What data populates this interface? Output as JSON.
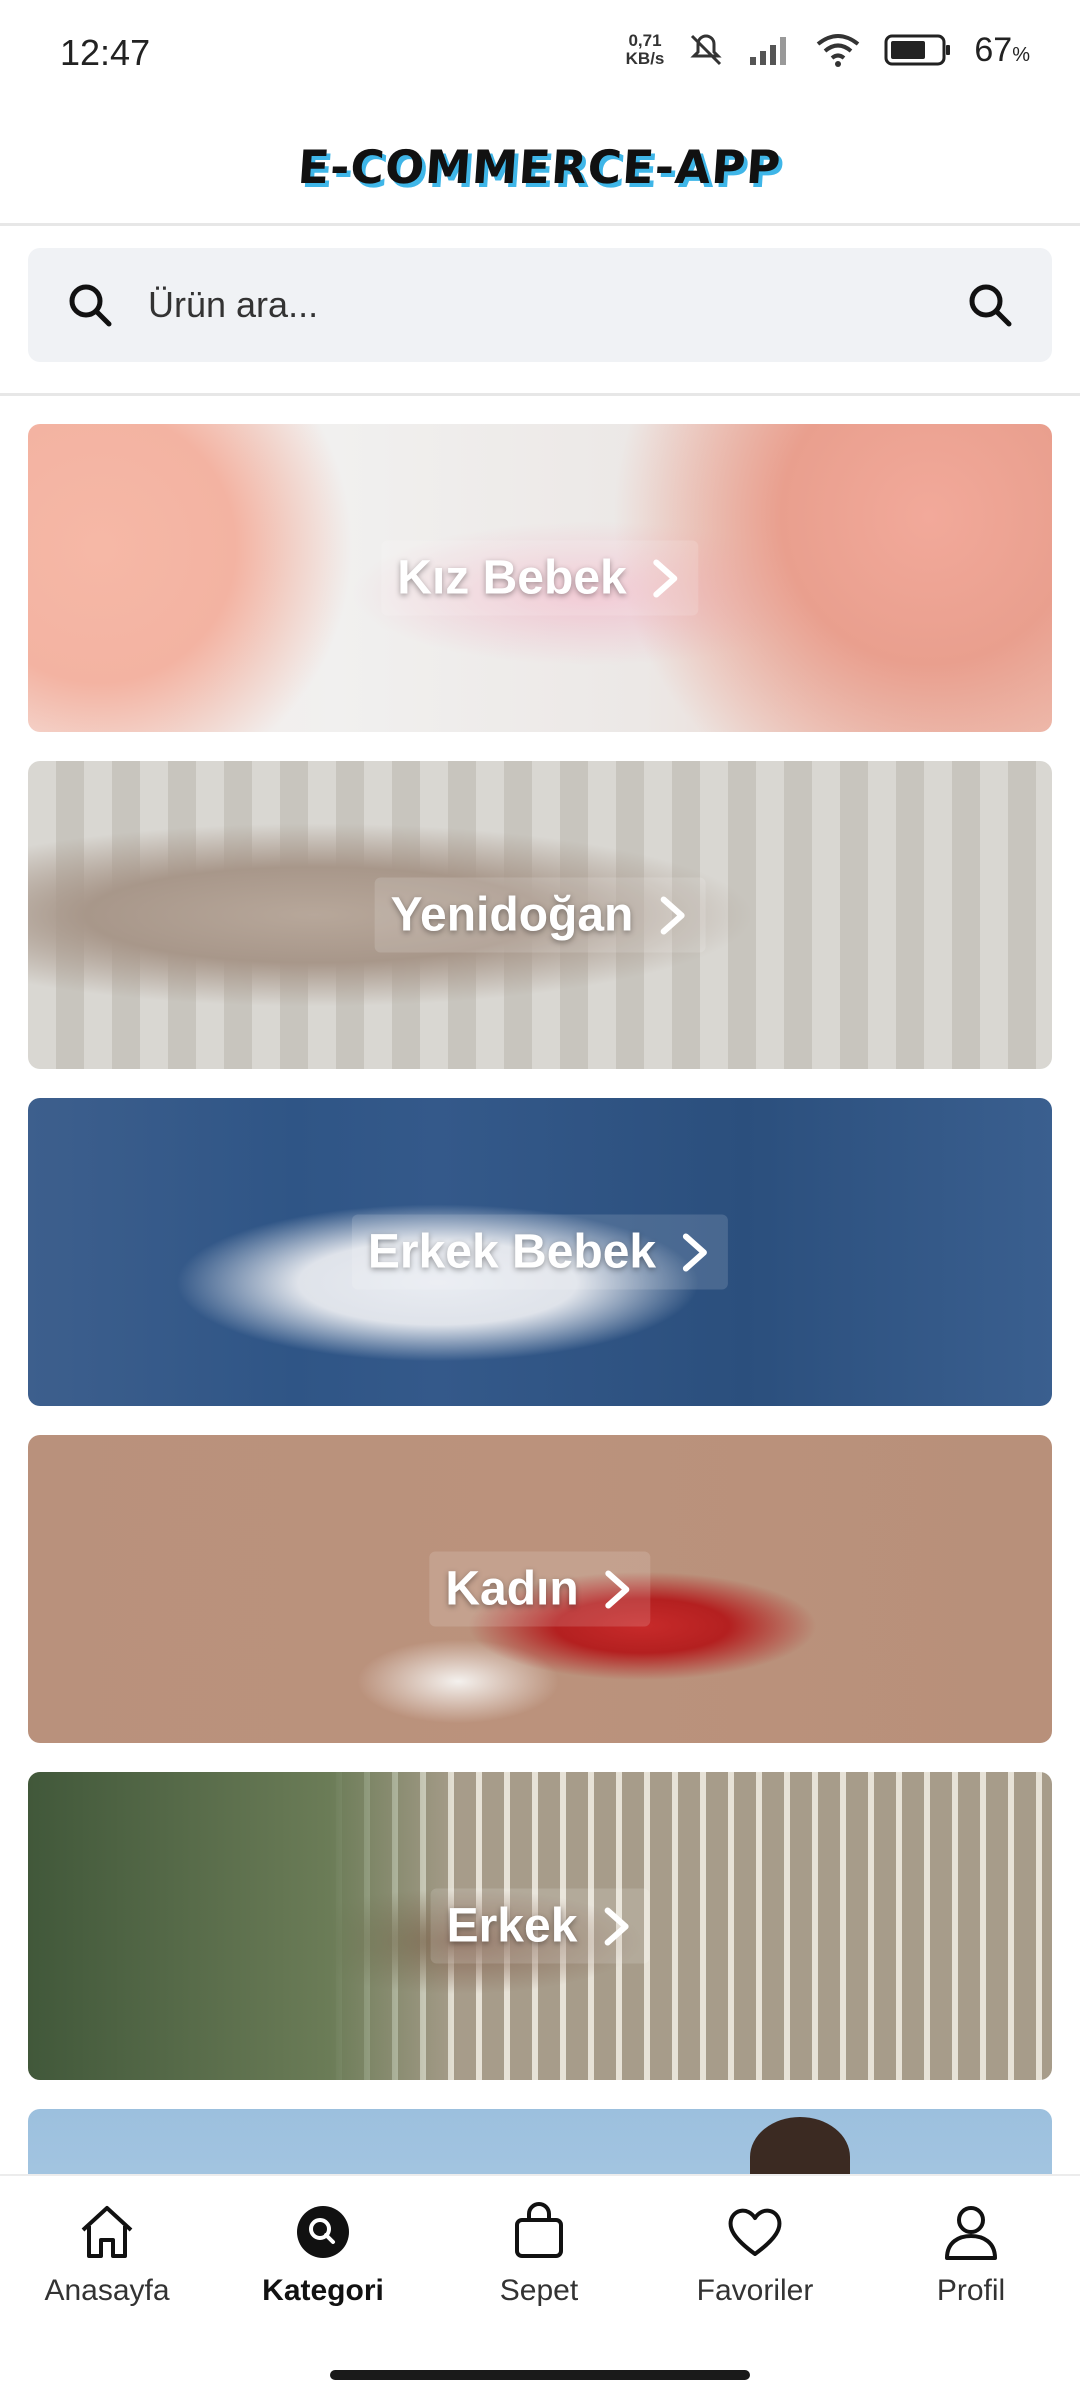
{
  "status_bar": {
    "time": "12:47",
    "net_speed_value": "0,71",
    "net_speed_unit": "KB/s",
    "battery_percent": "67",
    "battery_symbol": "%",
    "icons": [
      "mute-icon",
      "signal-icon",
      "wifi-icon",
      "battery-icon"
    ]
  },
  "header": {
    "logo_text": "E-COMMERCE-APP"
  },
  "search": {
    "placeholder": "Ürün ara...",
    "value": ""
  },
  "categories": [
    {
      "label": "Kız Bebek",
      "icon": "chevron-right-icon"
    },
    {
      "label": "Yenidoğan",
      "icon": "chevron-right-icon"
    },
    {
      "label": "Erkek Bebek",
      "icon": "chevron-right-icon"
    },
    {
      "label": "Kadın",
      "icon": "chevron-right-icon"
    },
    {
      "label": "Erkek",
      "icon": "chevron-right-icon"
    }
  ],
  "bottom_nav": {
    "items": [
      {
        "label": "Anasayfa",
        "icon": "home-icon",
        "active": false
      },
      {
        "label": "Kategori",
        "icon": "category-search-icon",
        "active": true
      },
      {
        "label": "Sepet",
        "icon": "bag-icon",
        "active": false
      },
      {
        "label": "Favoriler",
        "icon": "heart-icon",
        "active": false
      },
      {
        "label": "Profil",
        "icon": "user-icon",
        "active": false
      }
    ]
  },
  "colors": {
    "logo_shadow": "#3fb6e8",
    "search_bg": "#f0f2f5",
    "active_nav": "#111111"
  }
}
